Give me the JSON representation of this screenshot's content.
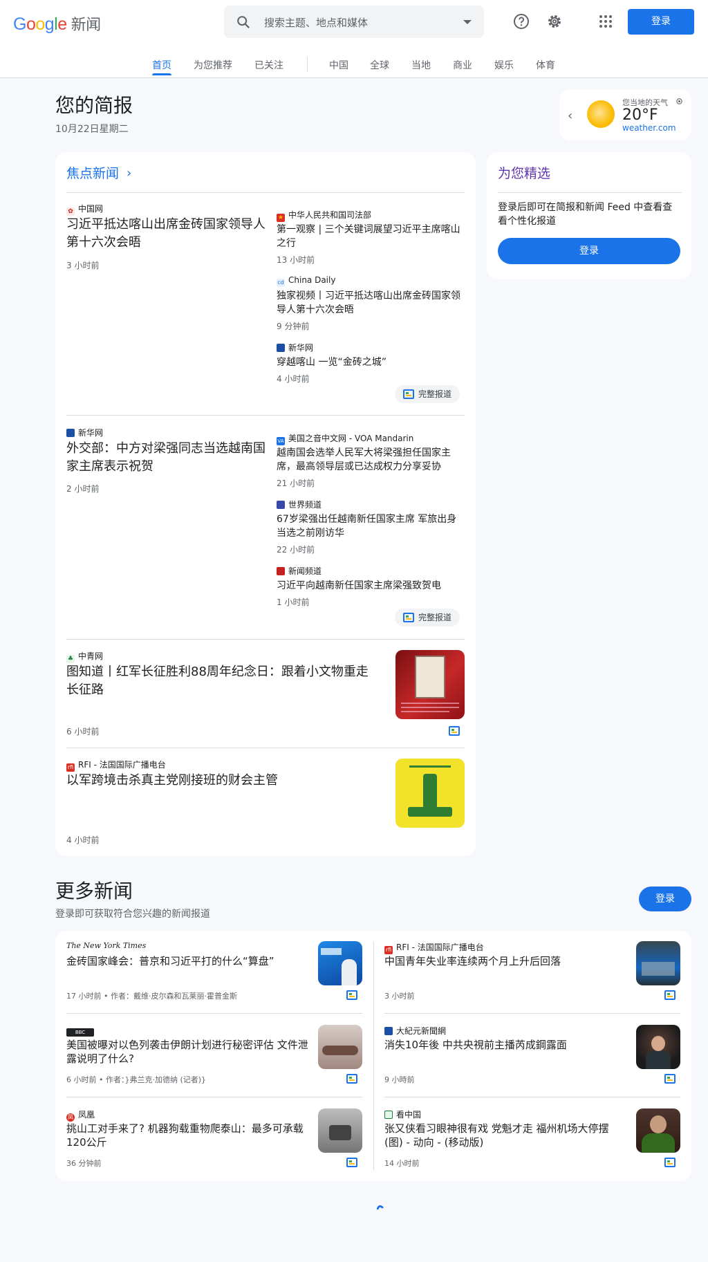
{
  "header": {
    "logo_letters": [
      "G",
      "o",
      "o",
      "g",
      "l",
      "e"
    ],
    "logo_suffix": "新闻",
    "search_placeholder": "搜索主题、地点和媒体",
    "signin_label": "登录",
    "icons": [
      "search-icon",
      "chevron-down-icon",
      "help-icon",
      "gear-icon",
      "apps-grid-icon"
    ]
  },
  "nav": {
    "tabs": [
      "首页",
      "为您推荐",
      "已关注",
      "中国",
      "全球",
      "当地",
      "商业",
      "娱乐",
      "体育"
    ],
    "active": "首页"
  },
  "briefing": {
    "title": "您的简报",
    "date": "10月22日星期二"
  },
  "weather": {
    "label": "您当地的天气",
    "temp": "20°F",
    "source": "weather.com",
    "icons": [
      "chevron-left-icon",
      "sun-icon",
      "location-icon"
    ]
  },
  "top_stories": {
    "heading": "焦点新闻",
    "full_coverage": "完整报道",
    "clusters": [
      {
        "main": {
          "source": "中国网",
          "title": "习近平抵达喀山出席金砖国家领导人第十六次会晤",
          "time": "3 小时前"
        },
        "related": [
          {
            "source": "中华人民共和国司法部",
            "title": "第一观察 | 三个关键词展望习近平主席喀山之行",
            "time": "13 小时前"
          },
          {
            "source": "China Daily",
            "title": "独家视频丨习近平抵达喀山出席金砖国家领导人第十六次会晤",
            "time": "9 分钟前"
          },
          {
            "source": "新华网",
            "title": "穿越喀山 一览“金砖之城”",
            "time": "4 小时前"
          }
        ]
      },
      {
        "main": {
          "source": "新华网",
          "title": "外交部：中方对梁强同志当选越南国家主席表示祝贺",
          "time": "2 小时前"
        },
        "related": [
          {
            "source": "美国之音中文网 - VOA Mandarin",
            "title": "越南国会选举人民军大将梁强担任国家主席，最高领导层或已达成权力分享妥协",
            "time": "21 小时前"
          },
          {
            "source": "世界频道",
            "title": "67岁梁强出任越南新任国家主席 军旅出身当选之前刚访华",
            "time": "22 小时前"
          },
          {
            "source": "新闻频道",
            "title": "习近平向越南新任国家主席梁强致贺电",
            "time": "1 小时前"
          }
        ]
      }
    ],
    "singles": [
      {
        "source": "中青网",
        "title": "图知道丨红军长征胜利88周年纪念日：跟着小文物重走长征路",
        "time": "6 小时前"
      },
      {
        "source": "RFI - 法国国际广播电台",
        "title": "以军跨境击杀真主党刚接班的财会主管",
        "time": "4 小时前"
      }
    ]
  },
  "picks": {
    "heading": "为您精选",
    "text": "登录后即可在简报和新闻 Feed 中查看查看个性化报道",
    "button": "登录"
  },
  "more_news": {
    "heading": "更多新闻",
    "subtitle": "登录即可获取符合您兴趣的新闻报道",
    "button": "登录",
    "items": [
      {
        "source": "The New York Times",
        "title": "金砖国家峰会：普京和习近平打的什么“算盘”",
        "time": "17 小时前 • 作者：戴维·皮尔森和瓦莱丽·霍普金斯"
      },
      {
        "source": "RFI - 法国国际广播电台",
        "title": "中国青年失业率连续两个月上升后回落",
        "time": "3 小时前"
      },
      {
        "source": "BBC",
        "title": "美国被曝对以色列袭击伊朗计划进行秘密评估 文件泄露说明了什么?",
        "time": "6 小时前 • 作者：}弗兰克·加德纳 (记者)}"
      },
      {
        "source": "大紀元新聞網",
        "title": "消失10年後 中共央視前主播芮成鋼露面",
        "time": "9 小時前"
      },
      {
        "source": "凤凰",
        "title": "挑山工对手来了? 机器狗载重物爬泰山：最多可承载120公斤",
        "time": "36 分钟前"
      },
      {
        "source": "看中国",
        "title": "张又侠看习眼神很有戏 党魁才走 福州机场大停摆(图) - 动向 - (移动版)",
        "time": "14 小时前"
      }
    ]
  }
}
